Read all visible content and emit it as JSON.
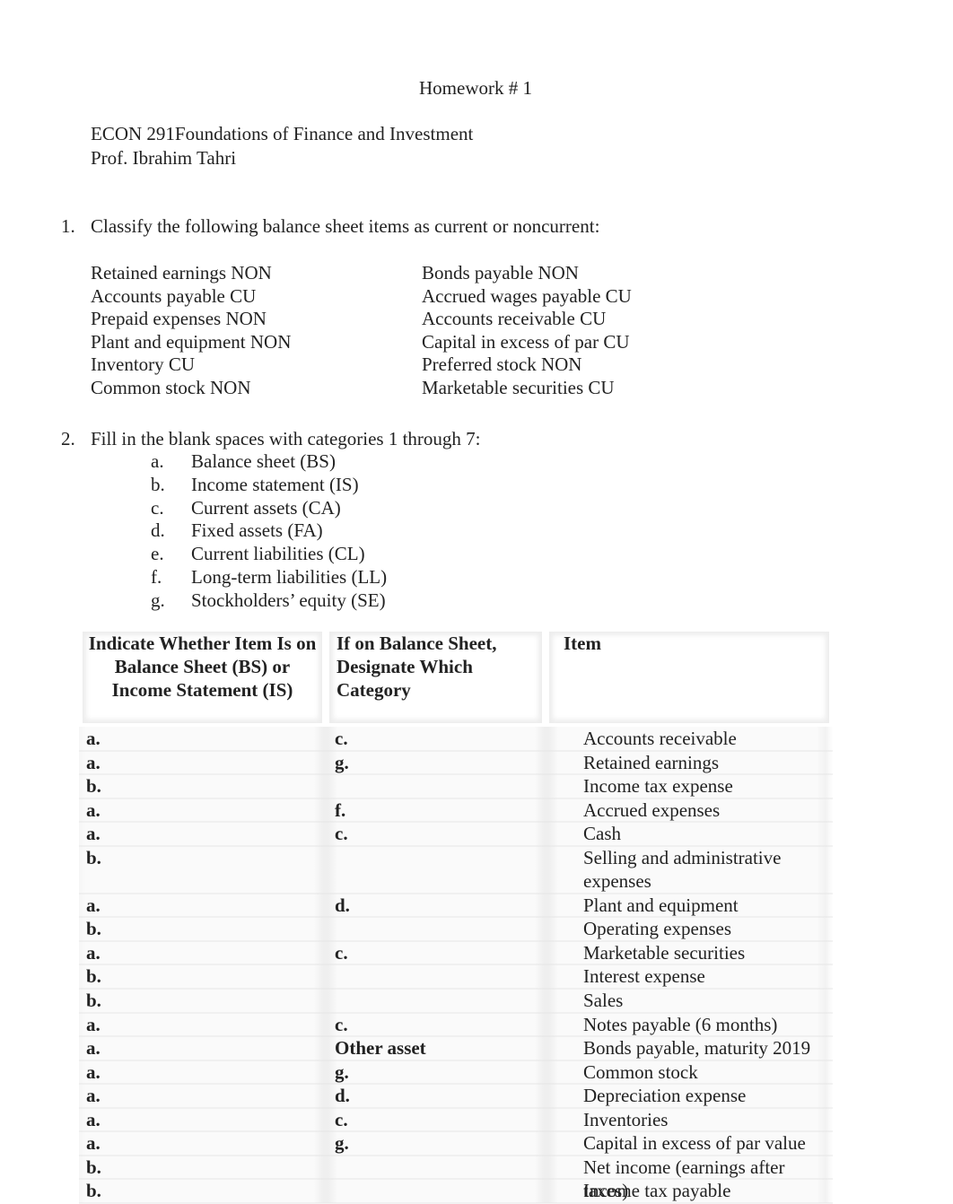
{
  "document": {
    "title": "Homework # 1",
    "course": "ECON 291Foundations of Finance and Investment",
    "professor": "Prof. Ibrahim Tahri"
  },
  "question1": {
    "number": "1.",
    "prompt": "Classify the following balance sheet items as current or noncurrent:",
    "left_items": [
      "Retained earnings NON",
      "Accounts payable CU",
      "Prepaid expenses NON",
      "Plant and equipment NON",
      "Inventory CU",
      "Common stock NON"
    ],
    "right_items": [
      "Bonds payable  NON",
      "Accrued wages payable CU",
      "Accounts receivable CU",
      "Capital in excess of par CU",
      "Preferred stock  NON",
      "Marketable securities CU"
    ]
  },
  "question2": {
    "number": "2.",
    "prompt": "Fill in the blank spaces with categories 1 through 7:",
    "categories": [
      {
        "letter": "a.",
        "label": "Balance sheet (BS)"
      },
      {
        "letter": "b.",
        "label": "Income statement (IS)"
      },
      {
        "letter": "c.",
        "label": "Current assets (CA)"
      },
      {
        "letter": "d.",
        "label": "Fixed assets (FA)"
      },
      {
        "letter": "e.",
        "label": "Current liabilities (CL)"
      },
      {
        "letter": "f.",
        "label": "Long-term liabilities (LL)"
      },
      {
        "letter": "g.",
        "label": "Stockholders’ equity (SE)"
      }
    ],
    "table": {
      "headers": [
        "Indicate Whether Item Is on Balance Sheet (BS) or Income Statement (IS)",
        "If on Balance Sheet, Designate Which Category",
        "Item"
      ],
      "rows": [
        {
          "statement": "a.",
          "category": "c.",
          "item": "Accounts receivable"
        },
        {
          "statement": "a.",
          "category": "g.",
          "item": "Retained earnings"
        },
        {
          "statement": "b.",
          "category": "",
          "item": "Income tax expense"
        },
        {
          "statement": "a.",
          "category": "f.",
          "item": "Accrued expenses"
        },
        {
          "statement": "a.",
          "category": "c.",
          "item": "Cash"
        },
        {
          "statement": "b.",
          "category": "",
          "item": "Selling and administrative expenses"
        },
        {
          "statement": "a.",
          "category": "d.",
          "item": "Plant and equipment"
        },
        {
          "statement": "b.",
          "category": "",
          "item": "Operating expenses"
        },
        {
          "statement": "a.",
          "category": "c.",
          "item": "Marketable securities"
        },
        {
          "statement": "b.",
          "category": "",
          "item": "Interest expense"
        },
        {
          "statement": "b.",
          "category": "",
          "item": "Sales"
        },
        {
          "statement": "a.",
          "category": "c.",
          "item": "Notes payable (6 months)"
        },
        {
          "statement": "a.",
          "category": "Other asset",
          "item": "Bonds payable, maturity 2019"
        },
        {
          "statement": "a.",
          "category": "g.",
          "item": "Common stock"
        },
        {
          "statement": "a.",
          "category": "d.",
          "item": "Depreciation expense"
        },
        {
          "statement": "a.",
          "category": "c.",
          "item": "Inventories"
        },
        {
          "statement": "a.",
          "category": "g.",
          "item": "Capital in excess of par value"
        },
        {
          "statement": "b.",
          "category": "",
          "item": "Net income (earnings after taxes)"
        },
        {
          "statement": "b.",
          "category": "",
          "item": "Income tax payable"
        }
      ]
    }
  }
}
